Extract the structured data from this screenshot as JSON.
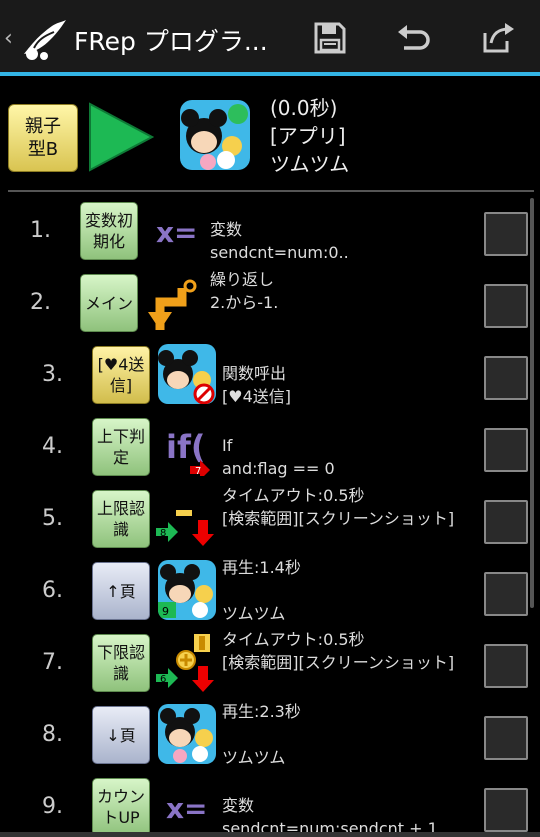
{
  "action_bar": {
    "back_glyph": "‹",
    "title": "FRep プログラ...",
    "icons": [
      "app-logo-icon",
      "save-icon",
      "undo-icon",
      "share-icon"
    ],
    "accent_color": "#33b5e5"
  },
  "header": {
    "type_label": "親子型B",
    "time": "(0.0秒)",
    "category": "[アプリ]",
    "app_name": "ツムツム"
  },
  "rows": [
    {
      "num": "1.",
      "cmd": "変数初期化",
      "line1": "変数",
      "line2": "sendcnt=num:0.."
    },
    {
      "num": "2.",
      "cmd": "メイン",
      "line1": "繰り返し",
      "line2": "2.から-1."
    },
    {
      "num": "3.",
      "cmd": "[♥4送信]",
      "line1": "関数呼出",
      "line2": "[♥4送信]"
    },
    {
      "num": "4.",
      "cmd": "上下判定",
      "line1": "If",
      "line2": "and:flag == 0",
      "badge": "7"
    },
    {
      "num": "5.",
      "cmd": "上限認識",
      "line1": "タイムアウト:0.5秒",
      "line2": "[検索範囲][スクリーンショット]",
      "badge": "8"
    },
    {
      "num": "6.",
      "cmd": "↑頁",
      "line1": "再生:1.4秒",
      "line2": "ツムツム",
      "badge": "9"
    },
    {
      "num": "7.",
      "cmd": "下限認識",
      "line1": "タイムアウト:0.5秒",
      "line2": "[検索範囲][スクリーンショット]",
      "badge": "6"
    },
    {
      "num": "8.",
      "cmd": "↓頁",
      "line1": "再生:2.3秒",
      "line2": "ツムツム"
    },
    {
      "num": "9.",
      "cmd": "カウントUP",
      "line1": "変数",
      "line2": "sendcnt=num:sendcnt + 1"
    }
  ]
}
